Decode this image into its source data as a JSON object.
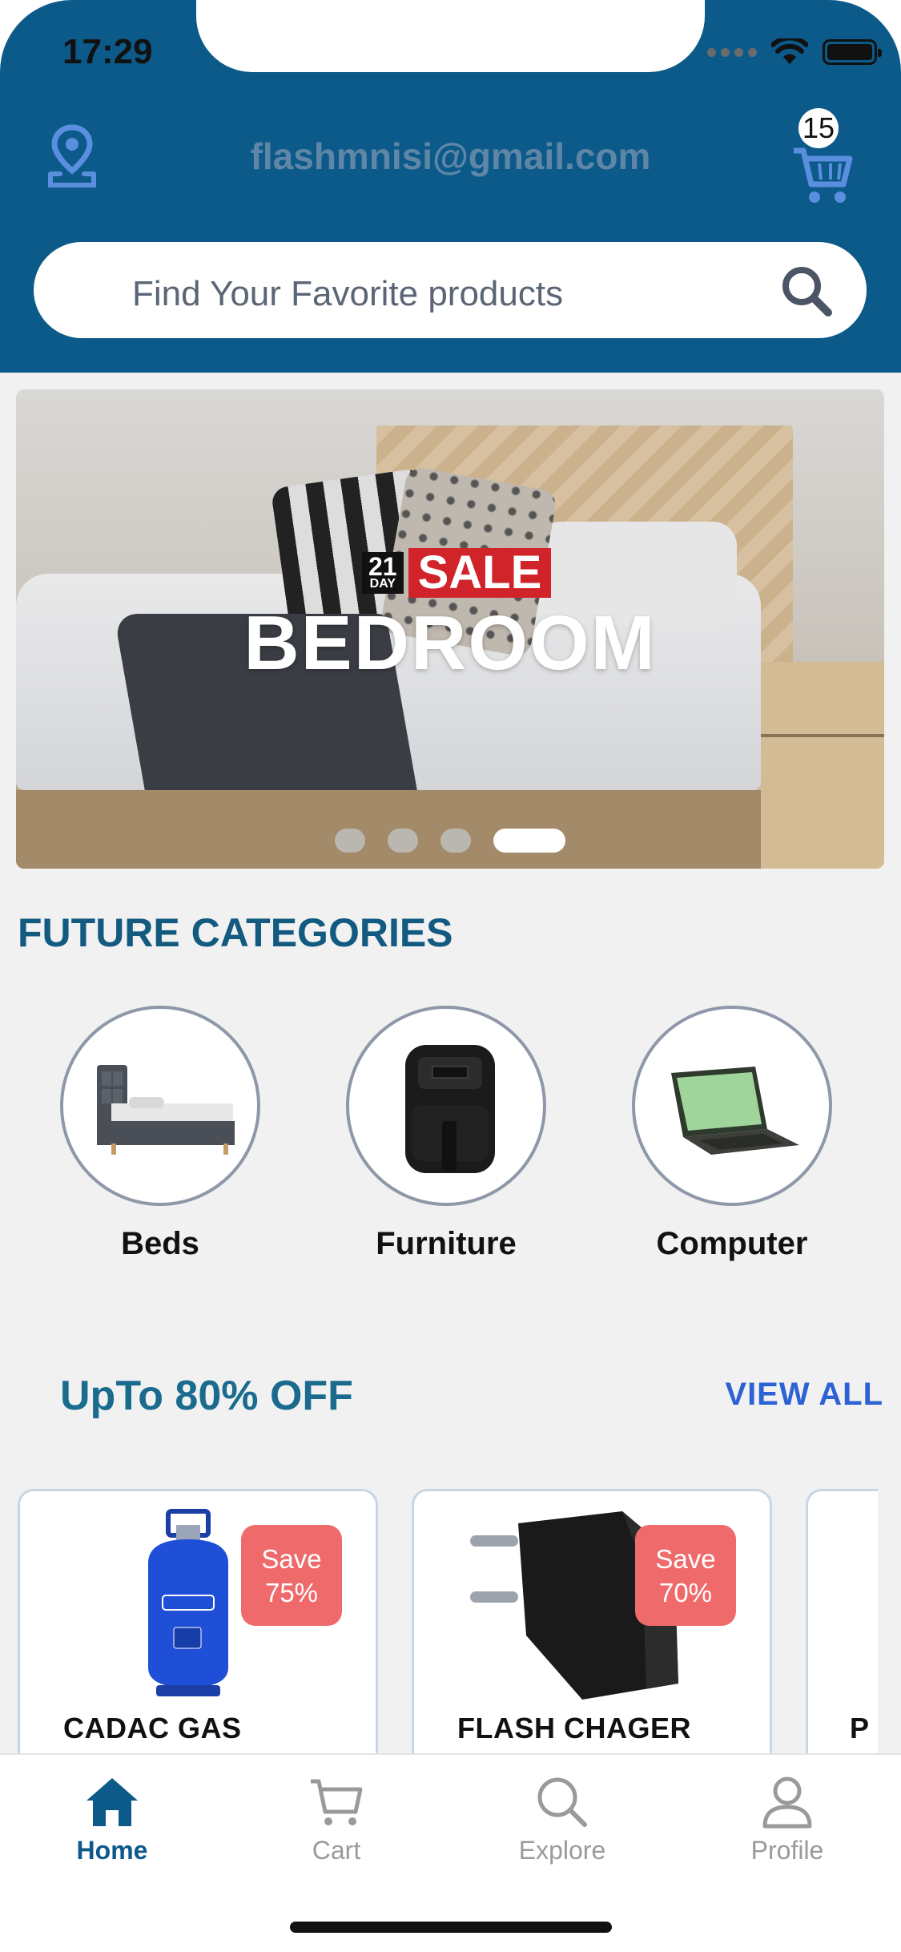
{
  "status_bar": {
    "time": "17:29"
  },
  "header": {
    "location_icon": "location-pin-icon",
    "email": "flashmnisi@gmail.com",
    "cart_icon": "shopping-cart-icon",
    "cart_count": "15"
  },
  "search": {
    "placeholder": "Find Your Favorite products",
    "icon": "search-icon"
  },
  "banner": {
    "badge_number": "21",
    "badge_unit": "DAY",
    "badge_sale": "SALE",
    "headline": "BEDROOM",
    "slide_count": 4,
    "active_slide": 4
  },
  "categories": {
    "title": "FUTURE CATEGORIES",
    "items": [
      {
        "label": "Beds",
        "icon": "bed-image"
      },
      {
        "label": "Furniture",
        "icon": "air-fryer-image"
      },
      {
        "label": "Computer",
        "icon": "laptop-image"
      }
    ]
  },
  "deals": {
    "title": "UpTo 80% OFF",
    "view_all": "VIEW ALL",
    "products": [
      {
        "name": "CADAC GAS",
        "save_label": "Save",
        "save_value": "75%"
      },
      {
        "name": "FLASH CHAGER",
        "save_label": "Save",
        "save_value": "70%"
      },
      {
        "name": "P"
      }
    ]
  },
  "nav": {
    "items": [
      {
        "label": "Home",
        "icon": "home-icon",
        "active": true
      },
      {
        "label": "Cart",
        "icon": "cart-icon"
      },
      {
        "label": "Explore",
        "icon": "search-icon"
      },
      {
        "label": "Profile",
        "icon": "user-icon"
      }
    ]
  },
  "colors": {
    "header_bg": "#0c5a8a",
    "accent_blue": "#2d62d4",
    "badge_red": "#ef6b6b",
    "title_blue": "#135a80"
  }
}
